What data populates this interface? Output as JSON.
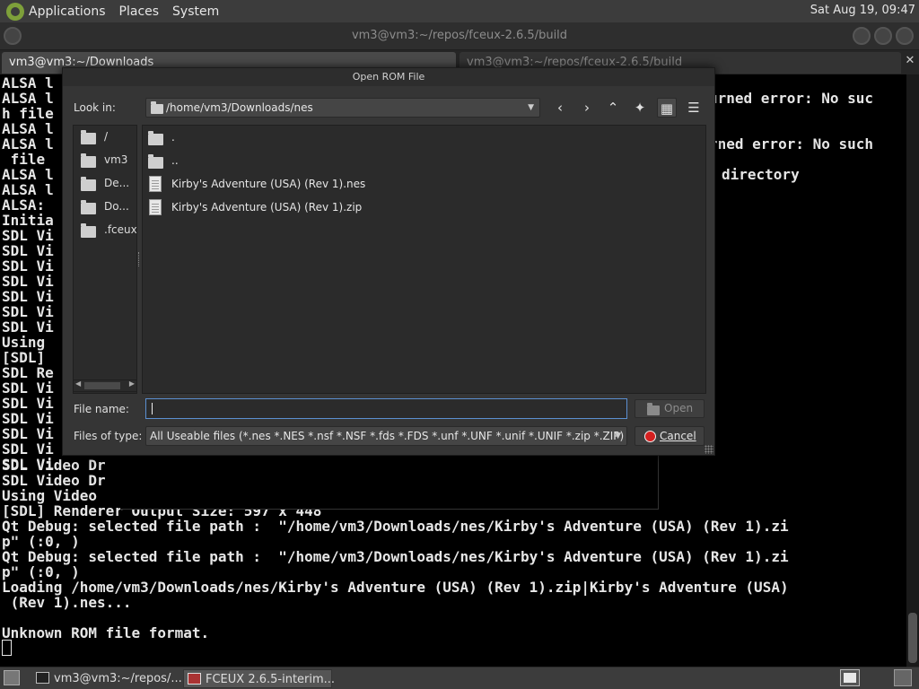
{
  "top_panel": {
    "menus": [
      "Applications",
      "Places",
      "System"
    ],
    "clock": "Sat Aug 19, 09:47"
  },
  "terminal": {
    "title": "vm3@vm3:~/repos/fceux-2.6.5/build",
    "tabs": [
      "vm3@vm3:~/Downloads",
      "vm3@vm3:~/repos/fceux-2.6.5/build"
    ],
    "left_lines": [
      "ALSA l",
      "ALSA l",
      "h file",
      "ALSA l",
      "ALSA l",
      " file",
      "ALSA l",
      "ALSA l",
      "ALSA: ",
      "Initia",
      "SDL Vi",
      "SDL Vi",
      "SDL Vi",
      "SDL Vi",
      "SDL Vi",
      "SDL Vi",
      "SDL Vi",
      "Using ",
      "[SDL] ",
      "SDL Re",
      "SDL Vi",
      "SDL Vi",
      "SDL Vi",
      "SDL Vi",
      "SDL Vi",
      "SDL Vi"
    ],
    "right_fragments": [
      "urned error: No suc",
      "rned error: No such",
      "directory"
    ],
    "bottom_lines": [
      "SDL Video Dr",
      "SDL Video Dr",
      "Using Video ",
      "[SDL] Renderer Output Size: 597 x 448",
      "Qt Debug: selected file path :  \"/home/vm3/Downloads/nes/Kirby's Adventure (USA) (Rev 1).zi",
      "p\" (:0, )",
      "Qt Debug: selected file path :  \"/home/vm3/Downloads/nes/Kirby's Adventure (USA) (Rev 1).zi",
      "p\" (:0, )",
      "Loading /home/vm3/Downloads/nes/Kirby's Adventure (USA) (Rev 1).zip|Kirby's Adventure (USA)",
      " (Rev 1).nes...",
      "",
      "Unknown ROM file format."
    ]
  },
  "dialog": {
    "title": "Open ROM File",
    "look_in_label": "Look in:",
    "look_in_value": "/home/vm3/Downloads/nes",
    "toolbar_icons": [
      "back-icon",
      "forward-icon",
      "parent-dir-icon",
      "new-folder-icon",
      "list-view-icon",
      "detail-view-icon"
    ],
    "sidebar": [
      "/",
      "vm3",
      "De...",
      "Do...",
      ".fceux"
    ],
    "files": [
      {
        "name": ".",
        "type": "folder"
      },
      {
        "name": "..",
        "type": "folder"
      },
      {
        "name": "Kirby's Adventure (USA) (Rev 1).nes",
        "type": "file"
      },
      {
        "name": "Kirby's Adventure (USA) (Rev 1).zip",
        "type": "file"
      }
    ],
    "filename_label": "File name:",
    "filename_value": "",
    "open_button": "Open",
    "filetype_label": "Files of type:",
    "filetype_value": "All Useable files (*.nes *.NES *.nsf *.NSF *.fds *.FDS *.unf *.UNF *.unif *.UNIF *.zip *.ZIP)",
    "cancel_button": "Cancel"
  },
  "taskbar": {
    "tasks": [
      "vm3@vm3:~/repos/...",
      "FCEUX 2.6.5-interim..."
    ]
  }
}
